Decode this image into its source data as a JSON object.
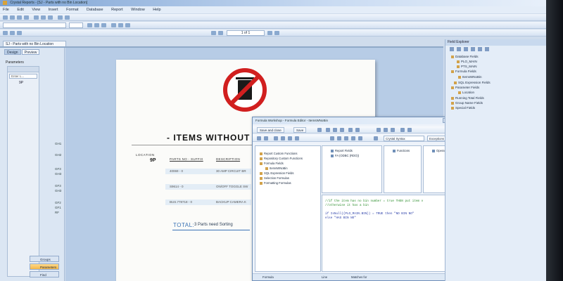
{
  "window": {
    "title": "Crystal Reports - [SJ - Parts with no Bin Location]"
  },
  "menu": [
    "File",
    "Edit",
    "View",
    "Insert",
    "Format",
    "Database",
    "Report",
    "Window",
    "Help"
  ],
  "toolbar": {
    "page_indicator": "1 of 1"
  },
  "doc_tab": {
    "label": "SJ - Parts with no Bin Location"
  },
  "left_panel": {
    "tabs": [
      "Design",
      "Preview"
    ],
    "parameters_header": "Parameters",
    "param_field_placeholder": "Enter L...",
    "param_value": "9P",
    "buttons": [
      "Groups",
      "Parameters",
      "Find"
    ]
  },
  "group_tree": [
    "GH1",
    "GH2",
    "GF3",
    "GH3",
    "GF3",
    "GH3",
    "GF2",
    "GF1",
    "RF"
  ],
  "report": {
    "title": "- ITEMS WITHOUT",
    "location_label": "LOCATION",
    "location_value": "9P",
    "columns": [
      "PARTS NO - SUFFIX",
      "DESCRIPTION"
    ],
    "rows": [
      {
        "part": "40069 - 0",
        "desc": "30 AMP CIRCUIT BR"
      },
      {
        "part": "S9614 - 0",
        "desc": "ON/OFF TOGGLE SW"
      },
      {
        "part": "BUS.778718 - 0",
        "desc": "BACKUP CAMERA K"
      }
    ],
    "total_label": "TOTAL:",
    "total_text": "3 Parts need Sorting"
  },
  "formula_workshop": {
    "title": "Formula Workshop - Formula Editor - ItemsWNoBin",
    "save_close_label": "Save and close",
    "save_label": "Save",
    "syntax_combo": "Crystal Syntax",
    "nulls_combo": "Exceptions For Nulls",
    "workshop_tree": [
      "Report Custom Functions",
      "Repository Custom Functions",
      "Formula Fields",
      "ItemsWNoBin",
      "SQL Expression Fields",
      "Selection Formulas",
      "Formatting Formulas"
    ],
    "fields_pane": [
      "Report Fields",
      "FA (ODBC (RDO))"
    ],
    "functions_pane": [
      "Functions"
    ],
    "operators_pane": [
      "Operators"
    ],
    "code_lines": [
      {
        "text": "//if the item has no bin number = true THEN put item v",
        "kind": "comment"
      },
      {
        "text": "//otherwise it has a bin",
        "kind": "comment"
      },
      {
        "text": "",
        "kind": "code"
      },
      {
        "text": "if IsNull({PLO_MAIN.BIN}) = TRUE then \"NO BIN NO\"",
        "kind": "code"
      },
      {
        "text": "else \"HAS BIN NO\"",
        "kind": "code"
      }
    ],
    "status": [
      "Formula",
      "Line",
      "Matches for"
    ]
  },
  "field_explorer": {
    "title": "Field Explorer",
    "tree": [
      "Database Fields",
      "PLO_MAIN",
      "PTS_MAIN",
      "Formula Fields",
      "ItemsWNoBin",
      "SQL Expression Fields",
      "Parameter Fields",
      "Location",
      "Running Total Fields",
      "Group Name Fields",
      "Special Fields"
    ]
  },
  "colors": {
    "logo_red": "#d11f1f",
    "total_blue": "#3a73b5",
    "comment_green": "#2f8f2f",
    "code_blue": "#2a3ea8"
  }
}
